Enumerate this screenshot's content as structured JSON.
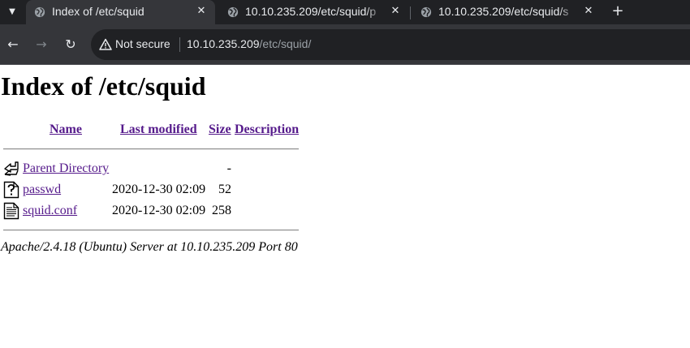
{
  "browser": {
    "tabs": [
      {
        "title": "Index of /etc/squid",
        "active": true
      },
      {
        "title": "10.10.235.209/etc/squid/p",
        "active": false
      },
      {
        "title": "10.10.235.209/etc/squid/s",
        "active": false
      }
    ],
    "omnibox": {
      "security_label": "Not secure",
      "url_host": "10.10.235.209",
      "url_path": "/etc/squid/"
    }
  },
  "page": {
    "heading": "Index of /etc/squid",
    "columns": {
      "name": "Name",
      "last_modified": "Last modified",
      "size": "Size",
      "description": "Description"
    },
    "rows": [
      {
        "icon": "back-icon",
        "name": "Parent Directory",
        "modified": "",
        "size": "-"
      },
      {
        "icon": "unknown-file-icon",
        "name": "passwd",
        "modified": "2020-12-30 02:09",
        "size": "52"
      },
      {
        "icon": "text-file-icon",
        "name": "squid.conf",
        "modified": "2020-12-30 02:09",
        "size": "258"
      }
    ],
    "footer": "Apache/2.4.18 (Ubuntu) Server at 10.10.235.209 Port 80"
  },
  "colors": {
    "tabbar_bg": "#202124",
    "toolbar_bg": "#35363a",
    "visited_link": "#551a8b"
  }
}
